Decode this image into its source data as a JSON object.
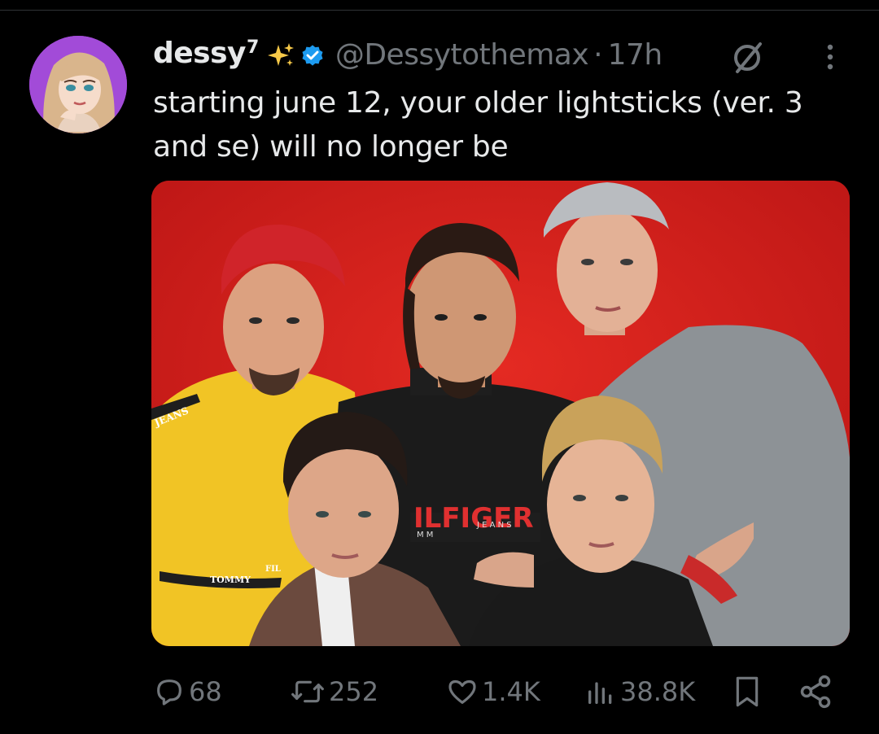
{
  "post": {
    "display_name": "dessy",
    "name_superscript": "7",
    "handle": "@Dessytothemax",
    "separator": "·",
    "time": "17h",
    "text": "starting june 12, your older lightsticks (ver. 3 and se) will no longer be"
  },
  "media": {
    "shirt_texts": [
      "JEANS",
      "TOMMY",
      "FIL",
      "ILFIGER",
      "M M",
      "J E A N S"
    ]
  },
  "actions": {
    "replies": "68",
    "reposts": "252",
    "likes": "1.4K",
    "views": "38.8K"
  },
  "icons": {
    "sparkle": "sparkles-icon",
    "verified": "verified-badge-icon",
    "grok": "grok-icon",
    "more": "more-options-icon",
    "reply": "reply-icon",
    "repost": "repost-icon",
    "like": "heart-icon",
    "views": "views-chart-icon",
    "bookmark": "bookmark-icon",
    "share": "share-icon"
  },
  "colors": {
    "background": "#000000",
    "text_primary": "#e7e9ea",
    "text_secondary": "#71767b",
    "verified_blue": "#1d9bf0",
    "avatar_bg": "#a24bd8",
    "photo_bg": "#d41f1f"
  }
}
